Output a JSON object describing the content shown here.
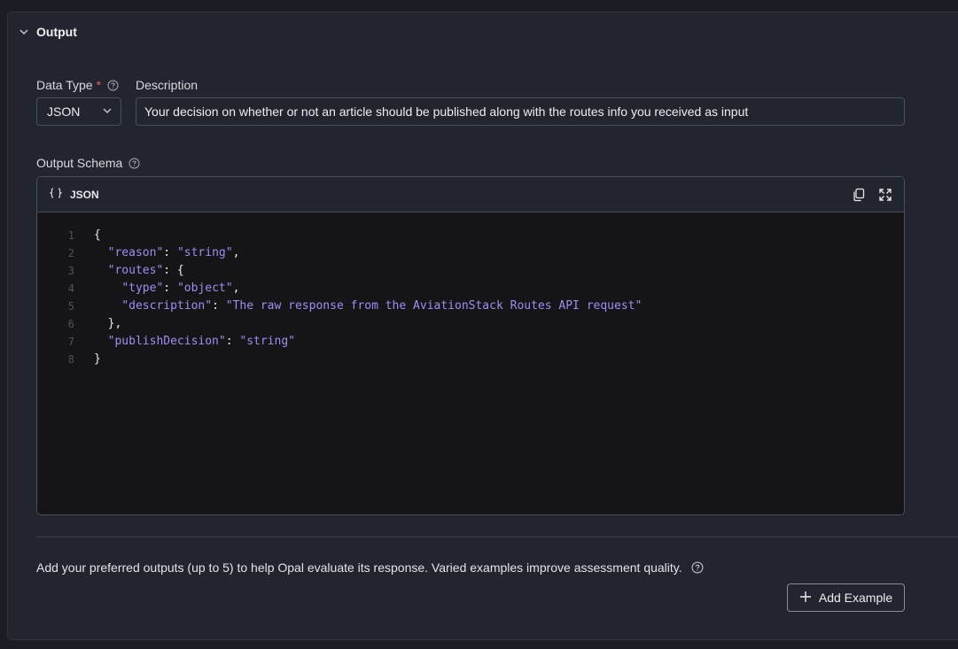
{
  "section": {
    "title": "Output",
    "expanded": true
  },
  "data_type": {
    "label": "Data Type",
    "required_mark": "*",
    "selected": "JSON"
  },
  "description": {
    "label": "Description",
    "value": "Your decision on whether or not an article should be published along with the routes info you received as input"
  },
  "output_schema": {
    "label": "Output Schema",
    "editor_language": "JSON",
    "lines": [
      {
        "num": "1",
        "indent": "",
        "parts": [
          {
            "t": "punc",
            "v": "{"
          }
        ]
      },
      {
        "num": "2",
        "indent": "  ",
        "parts": [
          {
            "t": "key",
            "v": "\"reason\""
          },
          {
            "t": "punc",
            "v": ": "
          },
          {
            "t": "str",
            "v": "\"string\""
          },
          {
            "t": "punc",
            "v": ","
          }
        ]
      },
      {
        "num": "3",
        "indent": "  ",
        "parts": [
          {
            "t": "key",
            "v": "\"routes\""
          },
          {
            "t": "punc",
            "v": ": {"
          }
        ]
      },
      {
        "num": "4",
        "indent": "    ",
        "parts": [
          {
            "t": "key",
            "v": "\"type\""
          },
          {
            "t": "punc",
            "v": ": "
          },
          {
            "t": "str",
            "v": "\"object\""
          },
          {
            "t": "punc",
            "v": ","
          }
        ]
      },
      {
        "num": "5",
        "indent": "    ",
        "parts": [
          {
            "t": "key",
            "v": "\"description\""
          },
          {
            "t": "punc",
            "v": ": "
          },
          {
            "t": "str",
            "v": "\"The raw response from the AviationStack Routes API request\""
          }
        ]
      },
      {
        "num": "6",
        "indent": "  ",
        "parts": [
          {
            "t": "punc",
            "v": "},"
          }
        ]
      },
      {
        "num": "7",
        "indent": "  ",
        "parts": [
          {
            "t": "key",
            "v": "\"publishDecision\""
          },
          {
            "t": "punc",
            "v": ": "
          },
          {
            "t": "str",
            "v": "\"string\""
          }
        ]
      },
      {
        "num": "8",
        "indent": "",
        "parts": [
          {
            "t": "punc",
            "v": "}"
          }
        ]
      }
    ]
  },
  "examples": {
    "hint": "Add your preferred outputs (up to 5) to help Opal evaluate its response. Varied examples improve assessment quality.",
    "add_button_label": "Add Example"
  },
  "icons": {
    "chevron": "chevron-down-icon",
    "help": "help-circle-icon",
    "braces": "braces-icon",
    "copy": "copy-icon",
    "expand": "expand-icon",
    "plus": "plus-icon"
  },
  "colors": {
    "background": "#1b1d25",
    "panel": "#22242e",
    "editor_bg": "#151518",
    "required": "#ef5f5f",
    "code_accent": "#a38bf0"
  }
}
